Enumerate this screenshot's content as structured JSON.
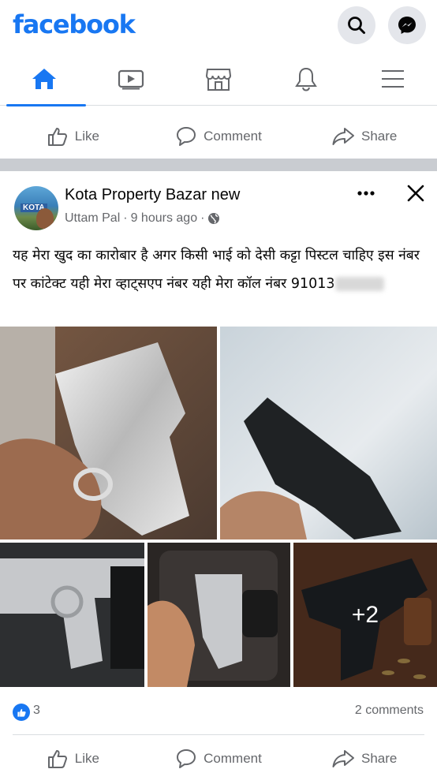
{
  "header": {
    "logo_text": "facebook",
    "brand_color": "#1877f2"
  },
  "nav": {
    "tabs": [
      {
        "name": "home",
        "icon": "home-icon",
        "active": true
      },
      {
        "name": "watch",
        "icon": "video-icon",
        "active": false
      },
      {
        "name": "marketplace",
        "icon": "marketplace-icon",
        "active": false
      },
      {
        "name": "notifications",
        "icon": "bell-icon",
        "active": false
      },
      {
        "name": "menu",
        "icon": "hamburger-icon",
        "active": false
      }
    ]
  },
  "prev_post_actions": {
    "like": "Like",
    "comment": "Comment",
    "share": "Share"
  },
  "post": {
    "page_name": "Kota Property Bazar new",
    "avatar_tag": "KOTA",
    "author": "Uttam Pal",
    "separator": "·",
    "time": "9 hours ago",
    "privacy_icon": "globe-icon",
    "text": "यह मेरा खुद का कारोबार है अगर किसी भाई को देसी कट्टा पिस्टल चाहिए इस नंबर पर कांटेक्ट यही मेरा व्हाट्सएप नंबर यही मेरा कॉल नंबर 91013",
    "extra_photos_label": "+2",
    "reaction_count": "3",
    "comments_count": "2 comments",
    "actions": {
      "like": "Like",
      "comment": "Comment",
      "share": "Share"
    }
  }
}
